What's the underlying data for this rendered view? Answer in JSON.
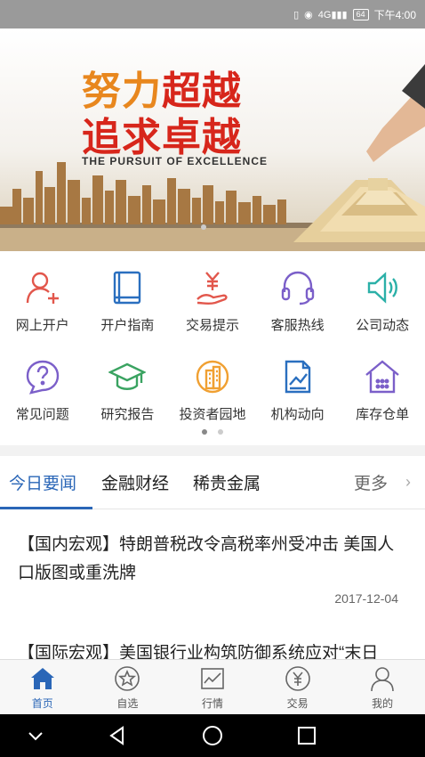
{
  "status_bar": {
    "signal": "4G",
    "battery": "64",
    "time": "下午4:00"
  },
  "banner": {
    "line1_part1": "努力",
    "line1_part2": "超越",
    "line2_part1": "追求",
    "line2_part2": "卓越",
    "subtitle": "THE PURSUIT OF EXCELLENCE"
  },
  "menu": {
    "row1": [
      {
        "label": "网上开户",
        "icon": "user-add-icon",
        "color": "#e2574c"
      },
      {
        "label": "开户指南",
        "icon": "book-icon",
        "color": "#2a6fbf"
      },
      {
        "label": "交易提示",
        "icon": "yen-hand-icon",
        "color": "#e2574c"
      },
      {
        "label": "客服热线",
        "icon": "headset-icon",
        "color": "#7b5fc9"
      },
      {
        "label": "公司动态",
        "icon": "speaker-icon",
        "color": "#2bb0a8"
      }
    ],
    "row2": [
      {
        "label": "常见问题",
        "icon": "question-icon",
        "color": "#7b5fc9"
      },
      {
        "label": "研究报告",
        "icon": "graduation-cap-icon",
        "color": "#3aa361"
      },
      {
        "label": "投资者园地",
        "icon": "city-building-icon",
        "color": "#f0a032"
      },
      {
        "label": "机构动向",
        "icon": "trend-chart-icon",
        "color": "#2a6fbf"
      },
      {
        "label": "库存仓单",
        "icon": "warehouse-icon",
        "color": "#7b5fc9"
      }
    ]
  },
  "tabs": {
    "items": [
      "今日要闻",
      "金融财经",
      "稀贵金属"
    ],
    "more": "更多",
    "active_color": "#2a66b7"
  },
  "news": [
    {
      "title": "【国内宏观】特朗普税改令高税率州受冲击 美国人口版图或重洗牌",
      "date": "2017-12-04"
    },
    {
      "title": "【国际宏观】美国银行业构筑防御系统应对“末日",
      "date": ""
    }
  ],
  "bottom_nav": {
    "items": [
      {
        "label": "首页",
        "icon": "home-icon"
      },
      {
        "label": "自选",
        "icon": "star-circle-icon"
      },
      {
        "label": "行情",
        "icon": "chart-icon"
      },
      {
        "label": "交易",
        "icon": "yen-circle-icon"
      },
      {
        "label": "我的",
        "icon": "person-icon"
      }
    ]
  }
}
